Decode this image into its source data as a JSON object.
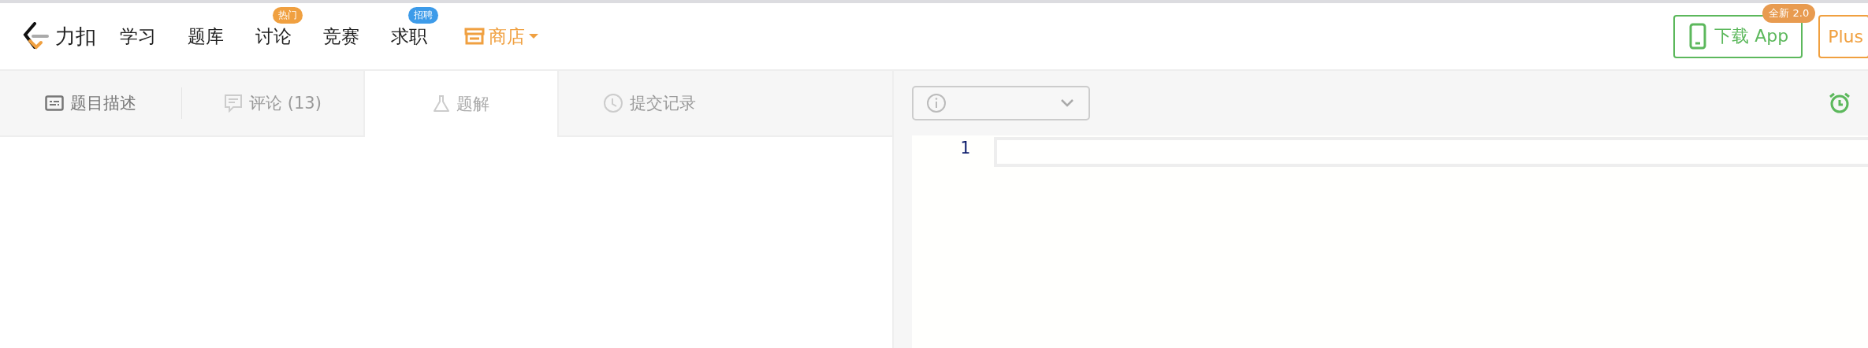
{
  "nav": {
    "logo_text": "力扣",
    "items": [
      {
        "label": "学习",
        "kind": "link"
      },
      {
        "label": "题库",
        "kind": "link"
      },
      {
        "label": "讨论",
        "kind": "link",
        "badge": "热门",
        "color": "#f0a040"
      },
      {
        "label": "竞赛",
        "kind": "link"
      },
      {
        "label": "求职",
        "kind": "link",
        "badge": "招聘",
        "color": "#3d9be9"
      },
      {
        "label": "商店",
        "kind": "store"
      }
    ],
    "download": {
      "label": "下载 App",
      "badge": "全新 2.0"
    },
    "plus": {
      "label": "Plus"
    }
  },
  "tabs": [
    {
      "label": "题目描述",
      "kind": "description",
      "selected": false,
      "disabled": false
    },
    {
      "label": "评论 (13)",
      "kind": "comments",
      "selected": false,
      "disabled": true
    },
    {
      "label": "题解",
      "kind": "solution",
      "selected": true,
      "disabled": false
    },
    {
      "label": "提交记录",
      "kind": "submissions",
      "selected": false,
      "disabled": true
    }
  ],
  "editor": {
    "line_numbers": [
      "1"
    ]
  }
}
